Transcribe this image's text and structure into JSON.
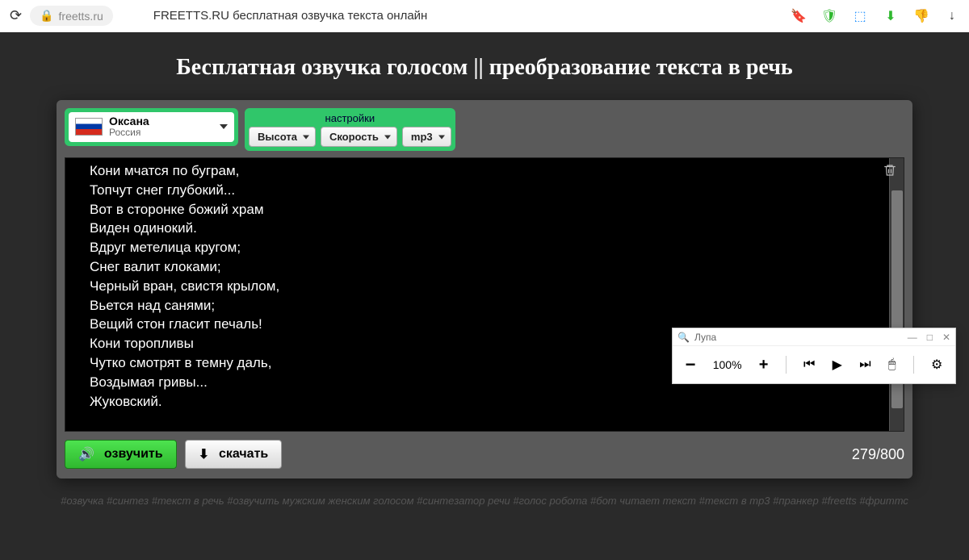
{
  "browser": {
    "url": "freetts.ru",
    "title": "FREETTS.RU бесплатная озвучка текста онлайн"
  },
  "heading": "Бесплатная озвучка голосом || преобразование текста в речь",
  "voice": {
    "name": "Оксана",
    "country": "Россия"
  },
  "settings": {
    "label": "настройки",
    "pitch": "Высота",
    "speed": "Скорость",
    "format": "mp3"
  },
  "text_content": "Кони мчатся по буграм,\nТопчут снег глубокий...\nВот в сторонке божий храм\nВиден одинокий.\nВдруг метелица кругом;\nСнег валит клоками;\nЧерный вран, свистя крылом,\nВьется над санями;\nВещий стон гласит печаль!\nКони торопливы\nЧутко смотрят в темну даль,\nВоздымая гривы...\nЖуковский.",
  "buttons": {
    "speak": "озвучить",
    "download": "скачать"
  },
  "char_count": "279/800",
  "hashtags": "#озвучка #синтез #текст в речь #озвучить мужским женским голосом #синтезатор речи #голос робота #бот читает текст #текст в mp3 #пранкер #freetts #фриттс",
  "magnifier": {
    "title": "Лупа",
    "zoom": "100%",
    "minimize": "—",
    "maximize": "□",
    "close": "✕"
  }
}
